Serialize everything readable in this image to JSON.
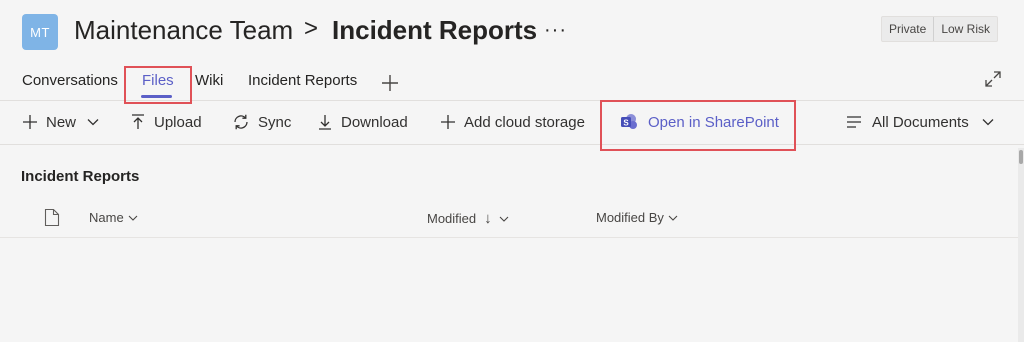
{
  "header": {
    "avatar_initials": "MT",
    "team_name": "Maintenance Team",
    "breadcrumb_separator": ">",
    "channel_name": "Incident Reports",
    "more_label": "···",
    "badges": [
      "Private",
      "Low Risk"
    ]
  },
  "tabs": [
    {
      "label": "Conversations",
      "active": false
    },
    {
      "label": "Files",
      "active": true
    },
    {
      "label": "Wiki",
      "active": false
    },
    {
      "label": "Incident Reports",
      "active": false
    }
  ],
  "tabs_add_icon": "plus-icon",
  "commands": {
    "new": "New",
    "upload": "Upload",
    "sync": "Sync",
    "download": "Download",
    "add_cloud_storage": "Add cloud storage",
    "open_sharepoint": "Open in SharePoint",
    "view": "All Documents"
  },
  "content": {
    "section_title": "Incident Reports",
    "columns": [
      "Name",
      "Modified",
      "Modified By"
    ],
    "sort_indicator": "↓"
  },
  "colors": {
    "accent": "#5b5fc7",
    "highlight": "#e05157",
    "avatar": "#7fb4e6"
  }
}
